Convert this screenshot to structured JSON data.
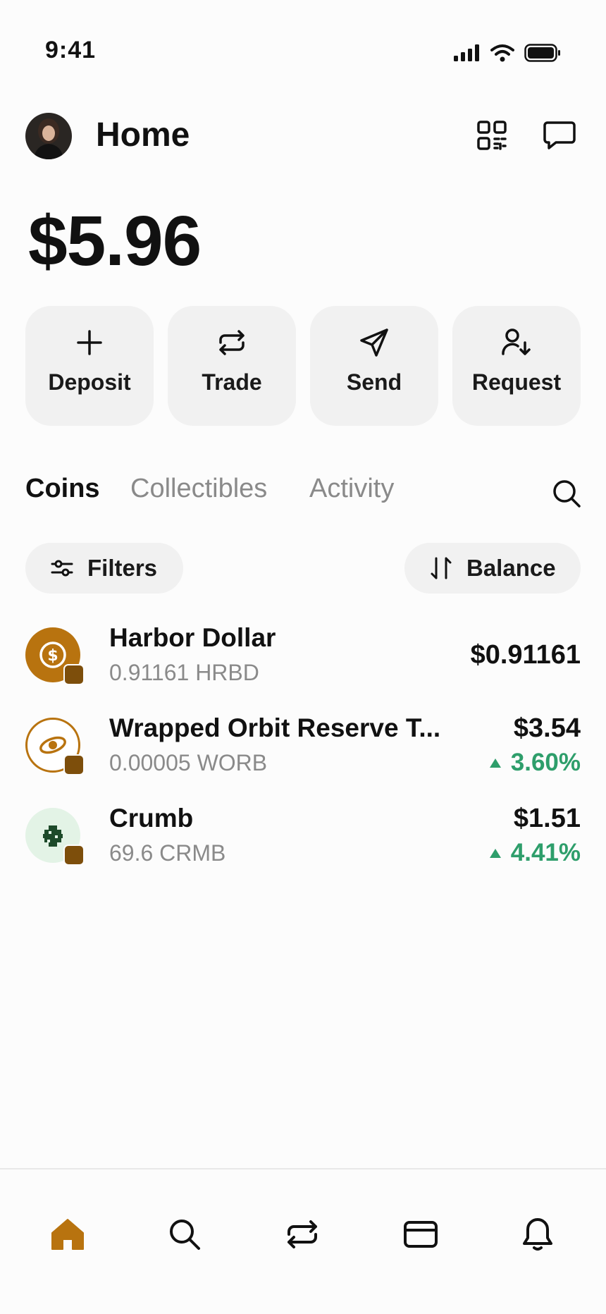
{
  "status": {
    "time": "9:41"
  },
  "header": {
    "title": "Home"
  },
  "balance": "$5.96",
  "actions": [
    {
      "label": "Deposit",
      "icon": "plus-icon"
    },
    {
      "label": "Trade",
      "icon": "swap-icon"
    },
    {
      "label": "Send",
      "icon": "send-icon"
    },
    {
      "label": "Request",
      "icon": "request-icon"
    }
  ],
  "tabs": [
    {
      "label": "Coins",
      "active": true
    },
    {
      "label": "Collectibles",
      "active": false
    },
    {
      "label": "Activity",
      "active": false
    }
  ],
  "filters": {
    "filters_label": "Filters",
    "sort_label": "Balance"
  },
  "coins": [
    {
      "name": "Harbor Dollar",
      "amount": "0.91161 HRBD",
      "value": "$0.91161",
      "change": ""
    },
    {
      "name": "Wrapped Orbit Reserve T...",
      "amount": "0.00005 WORB",
      "value": "$3.54",
      "change": "3.60%"
    },
    {
      "name": "Crumb",
      "amount": "69.6 CRMB",
      "value": "$1.51",
      "change": "4.41%"
    }
  ],
  "colors": {
    "accent": "#b8730f",
    "positive": "#2e9e6b",
    "muted": "#8a8a8a"
  }
}
